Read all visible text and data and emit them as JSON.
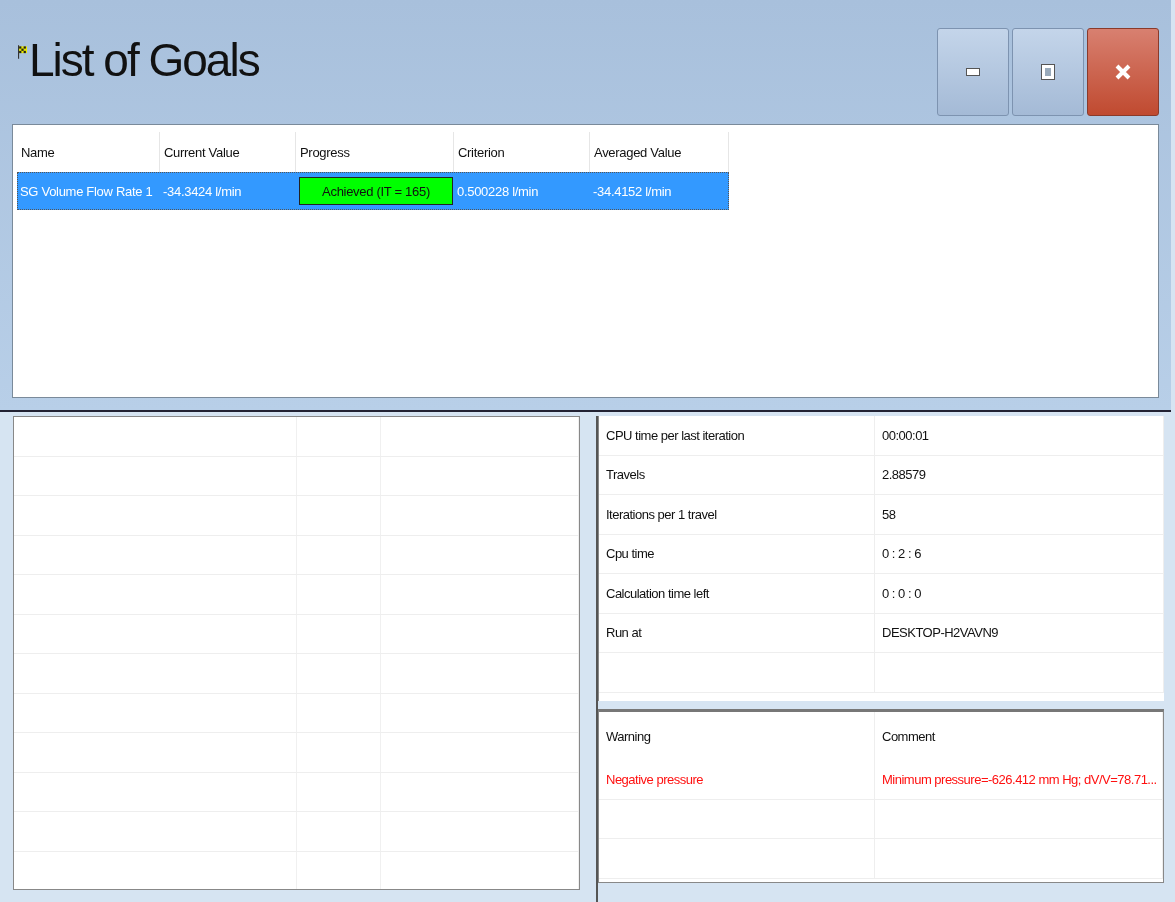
{
  "window": {
    "title": "List of Goals"
  },
  "goals": {
    "columns": [
      "Name",
      "Current Value",
      "Progress",
      "Criterion",
      "Averaged Value"
    ],
    "rows": [
      {
        "selected": true,
        "name": "SG Volume Flow Rate 1",
        "current_value": "-34.3424 l/min",
        "progress": {
          "label": "Achieved (IT = 165)",
          "level": 1
        },
        "criterion": "0.500228 l/min",
        "averaged_value": "-34.4152 l/min"
      }
    ]
  },
  "info": [
    {
      "label": "CPU time per last iteration",
      "value": "00:00:01"
    },
    {
      "label": "Travels",
      "value": "2.88579"
    },
    {
      "label": "Iterations per 1 travel",
      "value": "58"
    },
    {
      "label": "Cpu time",
      "value": "0 : 2 : 6"
    },
    {
      "label": "Calculation time left",
      "value": "0 : 0 : 0"
    },
    {
      "label": "Run at",
      "value": "DESKTOP-H2VAVN9"
    }
  ],
  "warnings": {
    "columns": [
      "Warning",
      "Comment"
    ],
    "rows": [
      {
        "warning": "Negative pressure",
        "comment": "Minimum pressure=-626.412 mm Hg; dV/V=78.71..."
      }
    ]
  }
}
